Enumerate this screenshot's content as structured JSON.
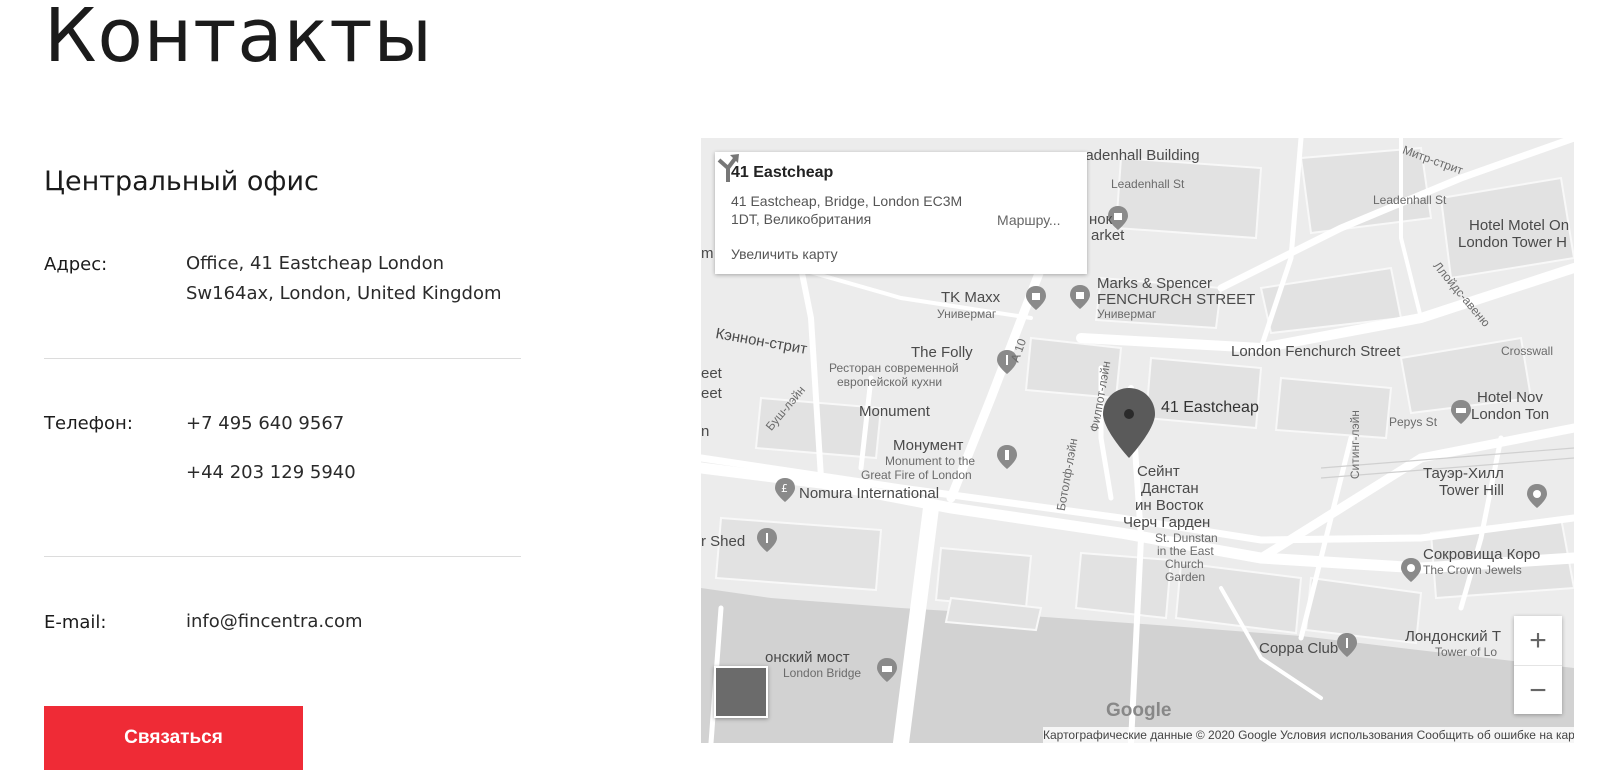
{
  "page": {
    "title": "Контакты",
    "office_heading": "Центральный офис",
    "address_label": "Адрес:",
    "address_line1": "Office, 41 Eastcheap London",
    "address_line2": "Sw164ax, London, United Kingdom",
    "phone_label": "Телефон:",
    "phone1": "+7 495 640 9567",
    "phone2": "+44 203 129 5940",
    "email_label": "E-mail:",
    "email": "info@fincentra.com",
    "contact_button": "Связаться",
    "accent_color": "#ef2b36"
  },
  "map": {
    "card": {
      "title": "41 Eastcheap",
      "address": "41 Eastcheap, Bridge, London EC3M 1DT, Великобритания",
      "enlarge": "Увеличить карту",
      "route": "Маршру..."
    },
    "marker_label": "41 Eastcheap",
    "labels": {
      "leadenhall_building": "eadenhall Building",
      "leadenhall_st1": "Leadenhall St",
      "leadenhall_st2": "Leadenhall St",
      "mitre_st": "Митр-стрит",
      "hotel_motel": "Hotel Motel On",
      "london_tower_h": "London Tower H",
      "nok": "нок",
      "arket": "arket",
      "marks1": "Marks & Spencer",
      "marks2": "FENCHURCH STREET",
      "marks3": "Универмаг",
      "tkmaxx1": "TK Maxx",
      "tkmaxx2": "Универмаг",
      "lloyds": "Ллойдс-авеню",
      "kennon": "Кэннон-стрит",
      "thefolly1": "The Folly",
      "thefolly2": "Ресторан современной",
      "thefolly3": "европейской кухни",
      "a10": "A 10",
      "fenchurch": "London Fenchurch Street",
      "crosswall": "Crosswall",
      "filpot": "Филпот-лэйн",
      "eet1": "eet",
      "eet2": "eet",
      "n": "n",
      "bush": "Буш-лэйн",
      "monument": "Monument",
      "pepys": "Pepys St",
      "hotel_nov": "Hotel Nov",
      "london_ton": "London Ton",
      "siting": "Ситинг-лэйн",
      "monument_ru": "Монумент",
      "monument_en1": "Monument to the",
      "monument_en2": "Great Fire of London",
      "botolph": "Ботолф-лэйн",
      "saint1": "Сейнт",
      "saint2": "Данстан",
      "saint3": "ин Восток",
      "saint4": "Черч Гарден",
      "saint5": "St. Dunstan",
      "saint6": "in the East",
      "saint7": "Church",
      "saint8": "Garden",
      "tower_hill1": "Тауэр-Хилл",
      "tower_hill2": "Tower Hill",
      "nomura": "Nomura International",
      "shed": "r Shed",
      "jewels1": "Сокровища Коро",
      "jewels2": "The Crown Jewels",
      "coppa": "Coppa Club",
      "ltower1": "Лондонский Т",
      "ltower2": "Tower of Lo",
      "bridge1": "онский мост",
      "bridge2": "London Bridge",
      "m": "m"
    },
    "google_logo": "Google",
    "attribution": "Картографические данные © 2020 Google   Условия использования   Сообщить об ошибке на карте",
    "zoom_in": "+",
    "zoom_out": "−"
  }
}
